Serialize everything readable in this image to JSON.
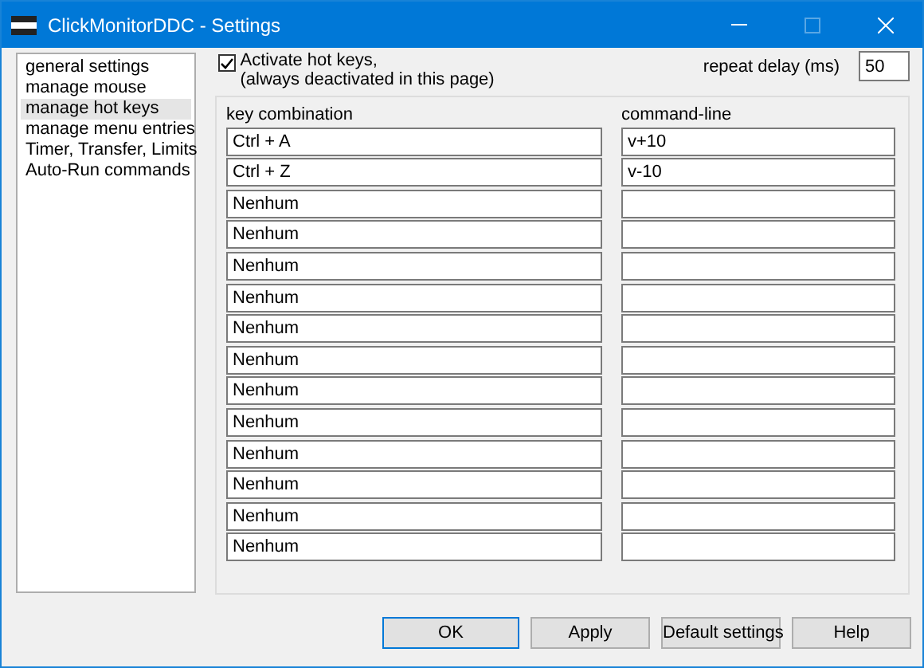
{
  "window": {
    "title": "ClickMonitorDDC - Settings",
    "maximize_disabled": true
  },
  "sidebar": {
    "items": [
      {
        "label": "general settings",
        "selected": false
      },
      {
        "label": "manage mouse",
        "selected": false
      },
      {
        "label": "manage hot keys",
        "selected": true
      },
      {
        "label": "manage menu entries",
        "selected": false
      },
      {
        "label": "Timer, Transfer, Limits",
        "selected": false
      },
      {
        "label": "Auto-Run commands",
        "selected": false
      }
    ]
  },
  "activate": {
    "label": "Activate hot keys,",
    "note": "(always deactivated in this page)",
    "checked": true
  },
  "repeat_delay": {
    "label": "repeat delay (ms)",
    "value": "50"
  },
  "table": {
    "columns": [
      "key combination",
      "command-line"
    ],
    "rows": [
      {
        "key": "Ctrl + A",
        "command": "v+10"
      },
      {
        "key": "Ctrl + Z",
        "command": "v-10"
      },
      {
        "key": "Nenhum"
      },
      {
        "key": "Nenhum"
      },
      {
        "key": "Nenhum"
      },
      {
        "key": "Nenhum"
      },
      {
        "key": "Nenhum"
      },
      {
        "key": "Nenhum"
      },
      {
        "key": "Nenhum"
      },
      {
        "key": "Nenhum"
      },
      {
        "key": "Nenhum"
      },
      {
        "key": "Nenhum"
      },
      {
        "key": "Nenhum"
      },
      {
        "key": "Nenhum"
      }
    ]
  },
  "buttons": [
    {
      "label": "OK",
      "default": true
    },
    {
      "label": "Apply",
      "default": false
    },
    {
      "label": "Default settings",
      "default": false
    },
    {
      "label": "Help",
      "default": false
    }
  ]
}
